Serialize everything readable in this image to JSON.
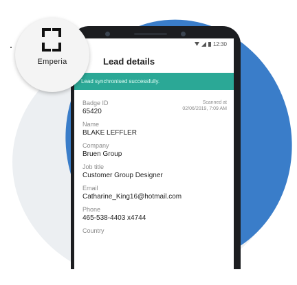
{
  "status_bar": {
    "time": "12:30"
  },
  "brand": {
    "name": "Emperia"
  },
  "app_bar": {
    "title": "Lead details"
  },
  "banner": {
    "message": "Lead synchronised successfully."
  },
  "badge": {
    "label": "Badge ID",
    "value": "65420",
    "scanned_label": "Scanned at",
    "scanned_value": "02/06/2019, 7:09 AM"
  },
  "fields": [
    {
      "label": "Name",
      "value": "BLAKE LEFFLER"
    },
    {
      "label": "Company",
      "value": "Bruen Group"
    },
    {
      "label": "Job title",
      "value": "Customer Group Designer"
    },
    {
      "label": "Email",
      "value": "Catharine_King16@hotmail.com"
    },
    {
      "label": "Phone",
      "value": "465-538-4403 x4744"
    },
    {
      "label": "Country",
      "value": ""
    }
  ],
  "colors": {
    "accent": "#2ba896",
    "background_shape": "#3a7dc9"
  }
}
